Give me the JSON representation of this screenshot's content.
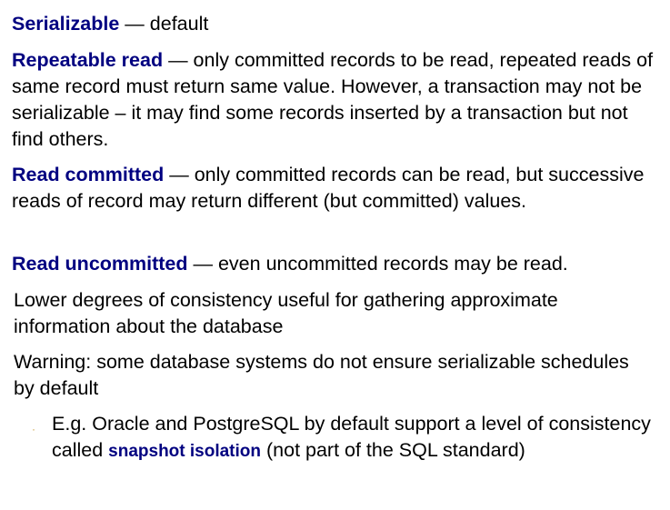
{
  "levels": [
    {
      "term": "Serializable",
      "desc": " — default"
    },
    {
      "term": "Repeatable read",
      "desc": " — only committed records to be read, repeated reads of same record must return same value.  However, a transaction may not be serializable – it may find some records inserted by a transaction but not find others."
    },
    {
      "term": "Read committed",
      "desc": " — only committed records can be read, but successive reads of record may return different (but committed) values."
    },
    {
      "term": "Read uncommitted",
      "desc": " — even uncommitted records may be read."
    }
  ],
  "notes": [
    "Lower degrees of consistency useful for gathering approximate information about the database",
    "Warning: some database systems do not ensure serializable schedules by default"
  ],
  "sub_bullet": {
    "marker": "·",
    "before": "E.g. Oracle and PostgreSQL by default support a level of consistency called ",
    "term": "snapshot isolation",
    "after": " (not part of the SQL standard)"
  },
  "colors": {
    "term": "#000080",
    "text": "#000000",
    "bullet": "#c8a040"
  }
}
